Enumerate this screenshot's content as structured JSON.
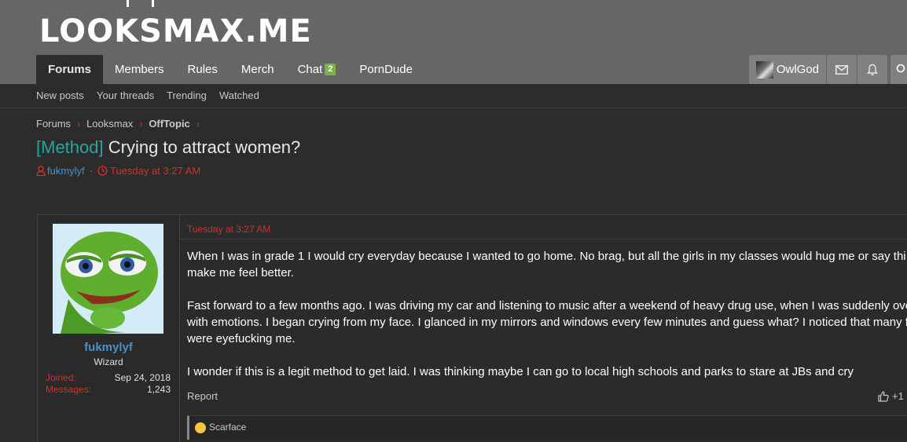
{
  "site": {
    "logo": "LOOKSMAX.ME"
  },
  "nav": {
    "tabs": [
      {
        "label": "Forums",
        "active": true
      },
      {
        "label": "Members"
      },
      {
        "label": "Rules"
      },
      {
        "label": "Merch"
      },
      {
        "label": "Chat",
        "badge": "2"
      },
      {
        "label": "PornDude"
      }
    ],
    "user": {
      "name": "OwlGod"
    },
    "icons": [
      "mail-icon",
      "bell-icon",
      "search-icon"
    ]
  },
  "subnav": {
    "items": [
      "New posts",
      "Your threads",
      "Trending",
      "Watched"
    ]
  },
  "breadcrumb": [
    "Forums",
    "Looksmax",
    "OffTopic"
  ],
  "thread": {
    "prefix": "[Method]",
    "title": "Crying to attract women?",
    "author": "fukmylyf",
    "time": "Tuesday at 3:27 AM"
  },
  "post": {
    "user": {
      "name": "fukmylyf",
      "role": "Wizard",
      "joined_label": "Joined:",
      "joined": "Sep 24, 2018",
      "messages_label": "Messages:",
      "messages": "1,243"
    },
    "date": "Tuesday at 3:27 AM",
    "paragraphs": [
      [
        "When I was in grade 1 I would cry everyday because I wanted to go home. No brag, but all the girls in my classes would hug me or say thi",
        "make me feel better."
      ],
      [
        "Fast forward to a few months ago. I was driving my car and listening to music after a weekend of heavy drug use, when I was suddenly ove",
        "with emotions. I began crying from my face. I glanced in my mirrors and windows every few minutes and guess what? I noticed that many f",
        "were eyefucking me."
      ],
      [
        "I wonder if this is a legit method to get laid. I was thinking maybe I can go to local high schools and parks to stare at JBs and cry"
      ]
    ],
    "report_label": "Report",
    "like_label": "+1",
    "reactions": {
      "user": "Scarface"
    }
  },
  "colors": {
    "header_bg": "#666666",
    "page_bg": "#2c2c2c",
    "accent_red": "#d32f2f",
    "username_blue": "#4a90c8",
    "prefix_teal": "#26a69a",
    "badge_green": "#7cb342"
  }
}
